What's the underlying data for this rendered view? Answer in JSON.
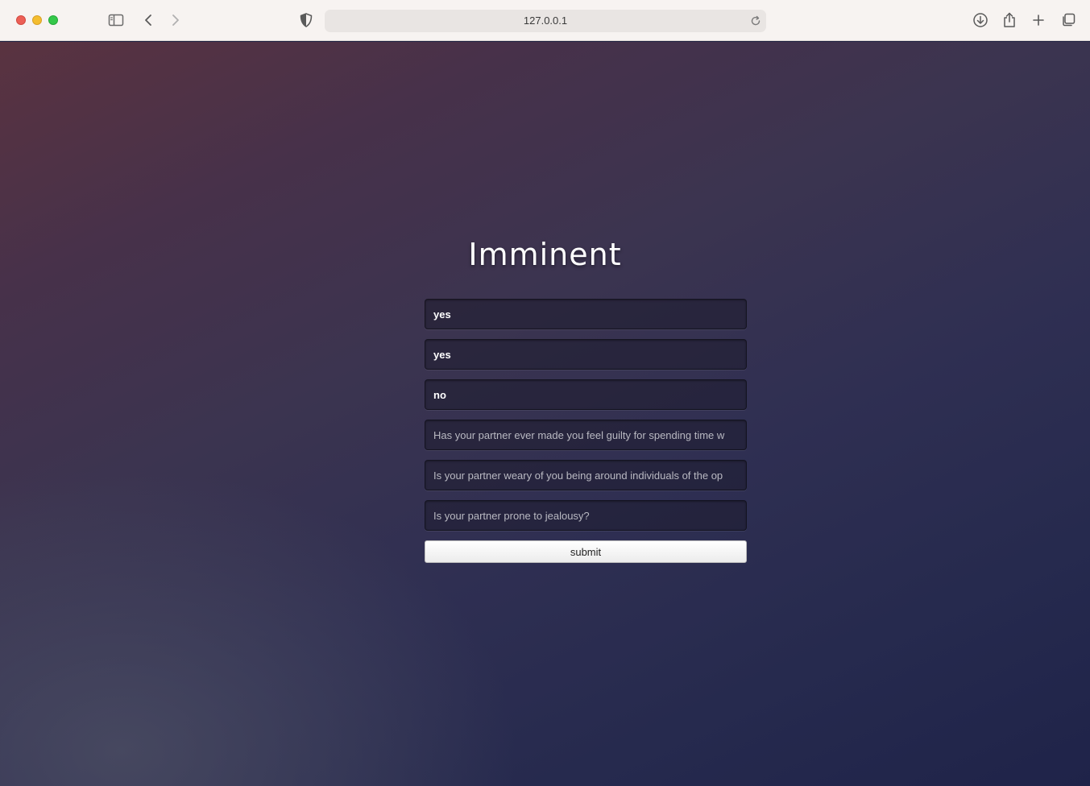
{
  "browser": {
    "url": "127.0.0.1",
    "icons": [
      "sidebar-icon",
      "back-icon",
      "forward-icon",
      "privacy-shield-icon",
      "reload-icon",
      "download-icon",
      "share-icon",
      "new-tab-icon",
      "tab-overview-icon"
    ]
  },
  "page": {
    "title": "Imminent",
    "fields": [
      {
        "value": "yes",
        "placeholder": ""
      },
      {
        "value": "yes",
        "placeholder": ""
      },
      {
        "value": "no",
        "placeholder": ""
      },
      {
        "value": "",
        "placeholder": "Has your partner ever made you feel guilty for spending time w"
      },
      {
        "value": "",
        "placeholder": "Is your partner weary of you being around individuals of the op"
      },
      {
        "value": "",
        "placeholder": "Is your partner prone to jealousy?"
      }
    ],
    "submit_label": "submit"
  }
}
